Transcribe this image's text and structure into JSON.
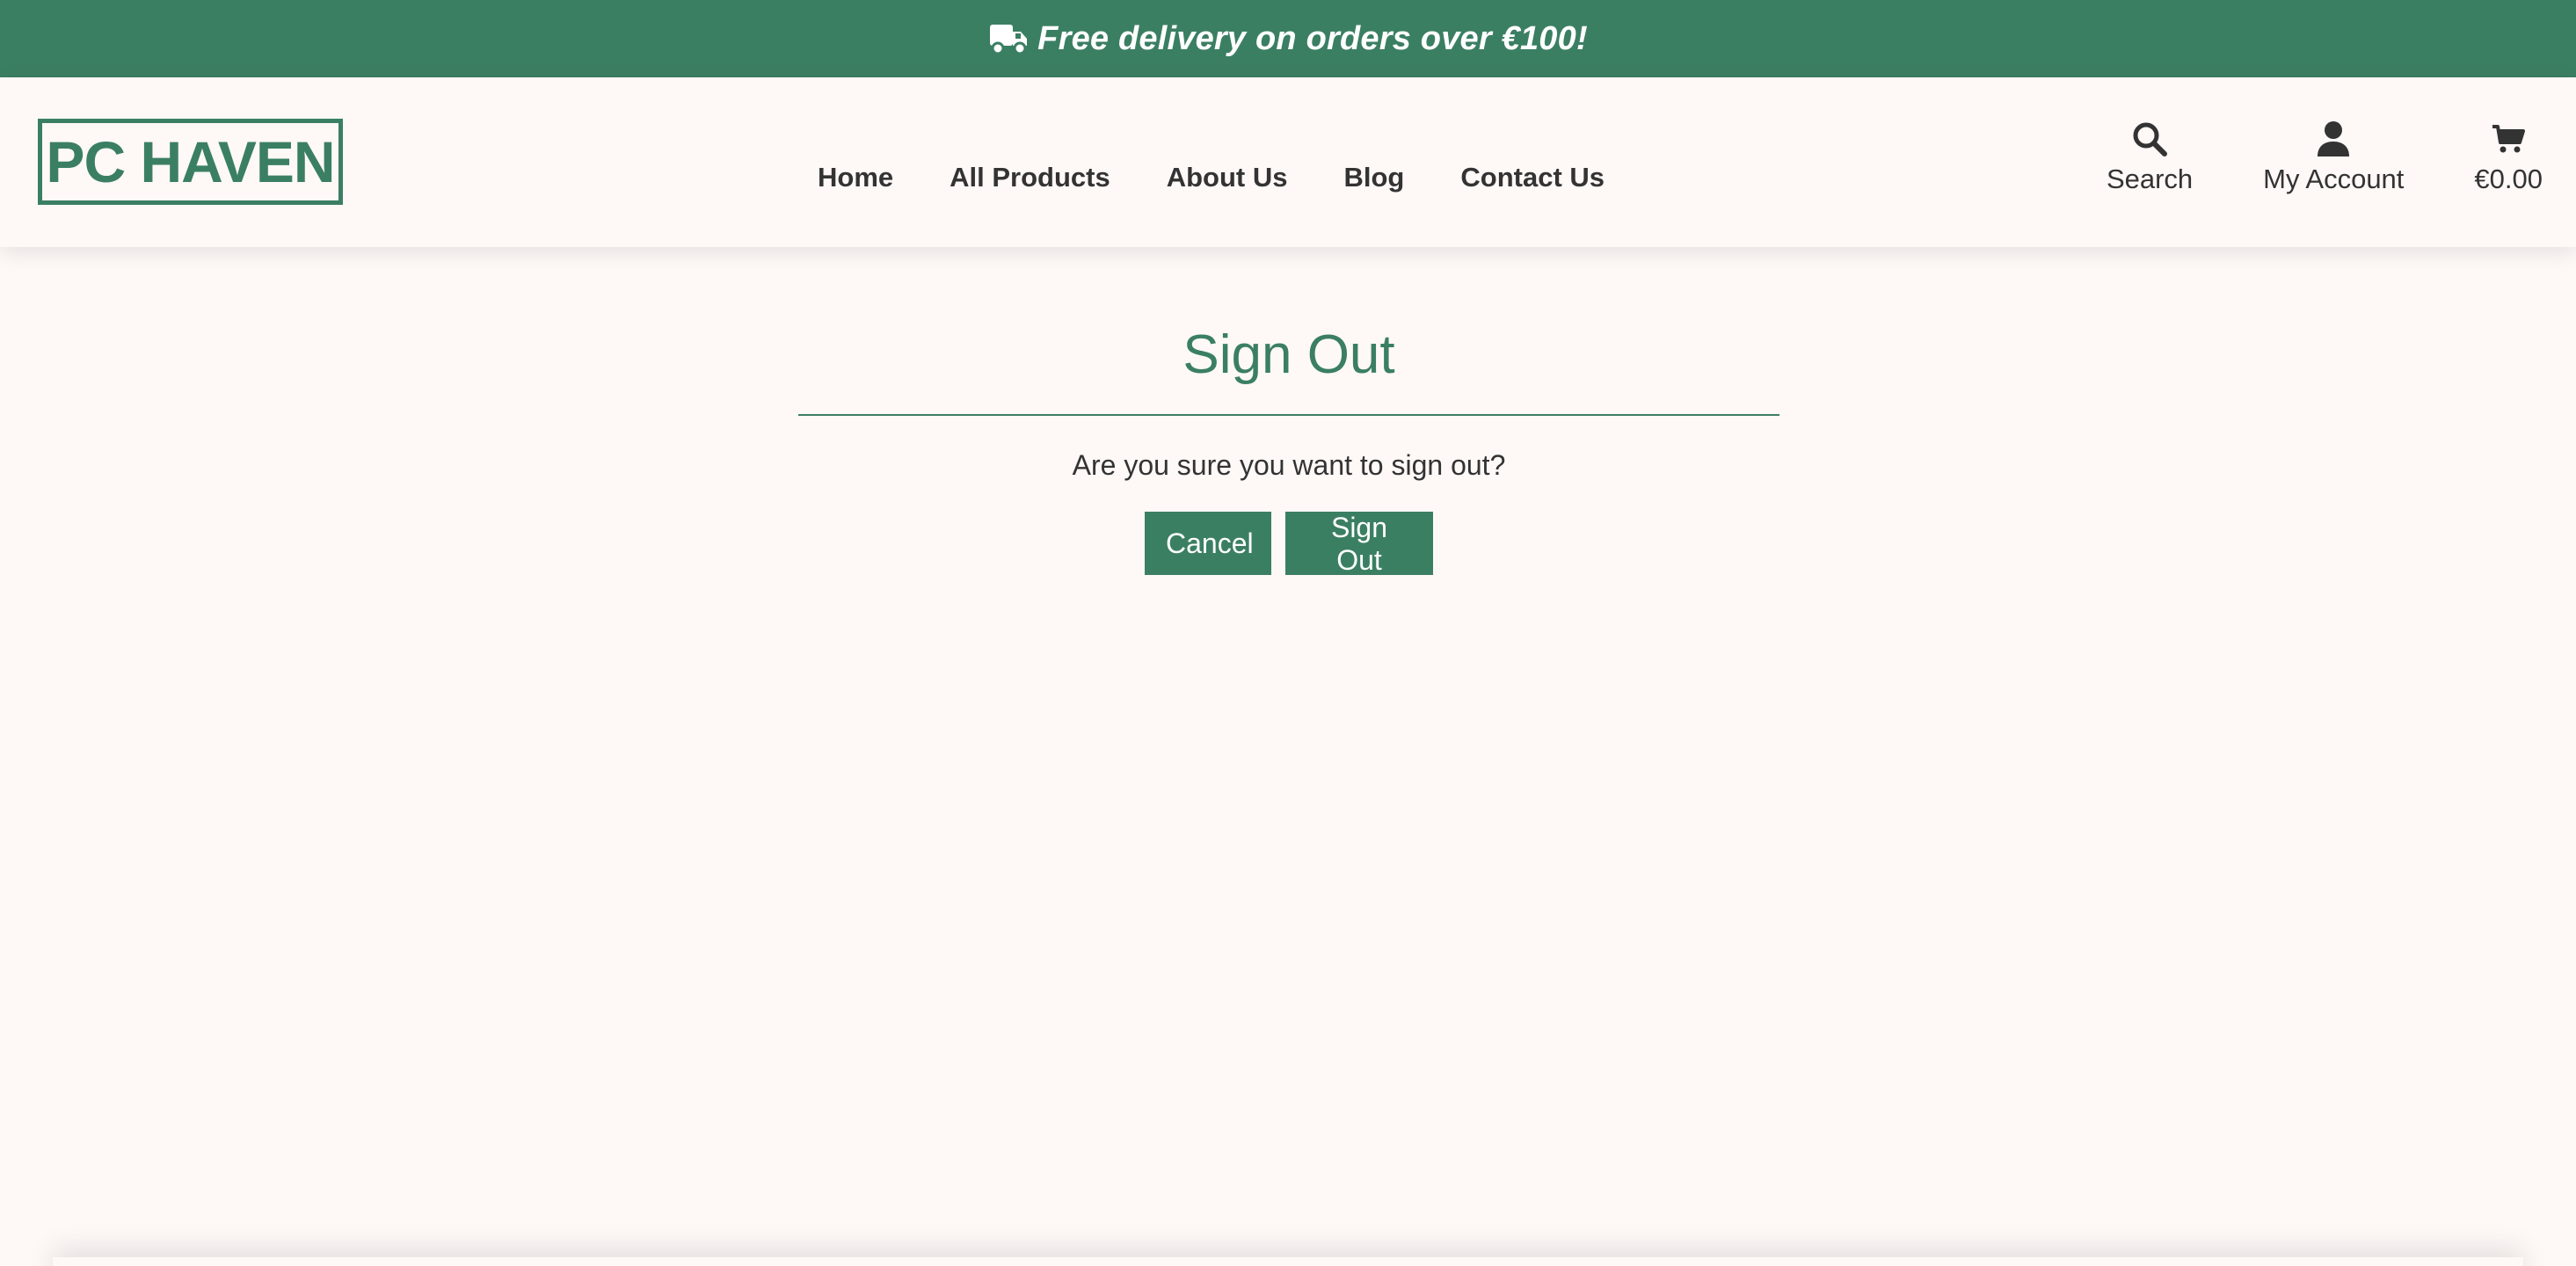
{
  "promo": {
    "text": "Free delivery on orders over €100!",
    "icon": "truck-icon"
  },
  "header": {
    "logo_text": "PC HAVEN",
    "nav": [
      {
        "label": "Home"
      },
      {
        "label": "All Products"
      },
      {
        "label": "About Us"
      },
      {
        "label": "Blog"
      },
      {
        "label": "Contact Us"
      }
    ],
    "actions": {
      "search_label": "Search",
      "account_label": "My Account",
      "cart_total": "€0.00"
    }
  },
  "main": {
    "title": "Sign Out",
    "confirm_text": "Are you sure you want to sign out?",
    "cancel_label": "Cancel",
    "signout_label": "Sign Out"
  },
  "colors": {
    "brand_green": "#3b7f63",
    "background": "#fef8f7",
    "text": "#333333"
  }
}
